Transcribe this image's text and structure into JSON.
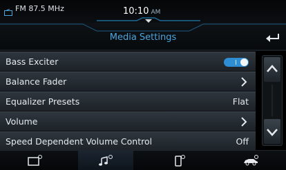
{
  "status_bar": {
    "radio_source": "FM 87.5 MHz",
    "clock_time": "10:10",
    "clock_ampm": "AM"
  },
  "header": {
    "title": "Media Settings"
  },
  "settings": {
    "items": [
      {
        "label": "Bass Exciter",
        "control": "toggle",
        "toggle_on": true
      },
      {
        "label": "Balance Fader",
        "control": "chevron"
      },
      {
        "label": "Equalizer Presets",
        "control": "value",
        "value": "Flat"
      },
      {
        "label": "Volume",
        "control": "chevron"
      },
      {
        "label": "Speed Dependent Volume Control",
        "control": "value",
        "value": "Off"
      }
    ]
  },
  "bottom_nav": {
    "tabs": [
      {
        "icon": "screen-settings-icon",
        "active": false
      },
      {
        "icon": "music-settings-icon",
        "active": true
      },
      {
        "icon": "phone-settings-icon",
        "active": false
      },
      {
        "icon": "vehicle-settings-icon",
        "active": false
      }
    ]
  },
  "colors": {
    "accent": "#4aa6df",
    "toggle_on": "#2f8ed3",
    "row_top": "#2e363d",
    "row_bottom": "#1c2227",
    "background": "#000000"
  }
}
